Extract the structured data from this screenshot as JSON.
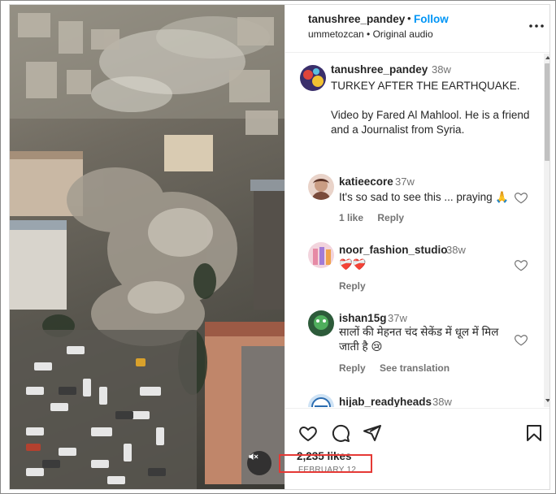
{
  "header": {
    "username": "tanushree_pandey",
    "separator": "•",
    "follow_label": "Follow",
    "location": "ummetozcan",
    "audio": "Original audio",
    "more_icon": "more-horizontal-icon"
  },
  "caption": {
    "username": "tanushree_pandey",
    "time": "38w",
    "line1": "TURKEY AFTER THE EARTHQUAKE.",
    "line2": "Video by Fared Al Mahlool. He is a friend and a Journalist from Syria."
  },
  "comments": [
    {
      "username": "katieecore",
      "time": "37w",
      "text": "It's so sad to see this ... praying 🙏",
      "likes": "1 like",
      "reply": "Reply",
      "translate": ""
    },
    {
      "username": "noor_fashion_studio",
      "time": "38w",
      "text": "❤️‍🩹❤️‍🩹",
      "likes": "",
      "reply": "Reply",
      "translate": ""
    },
    {
      "username": "ishan15g",
      "time": "37w",
      "text": "सालों की मेहनत चंद सेकेंड में धूल में मिल जाती है 😢",
      "likes": "",
      "reply": "Reply",
      "translate": "See translation"
    },
    {
      "username": "hijab_readyheads",
      "time": "38w",
      "text": "",
      "likes": "",
      "reply": "",
      "translate": ""
    }
  ],
  "actions": {
    "likes_count": "2,235 likes",
    "date": "FEBRUARY 12",
    "icons": [
      "heart-icon",
      "comment-icon",
      "share-icon",
      "bookmark-icon"
    ]
  },
  "media": {
    "mute_icon": "speaker-muted-icon"
  },
  "colors": {
    "follow_blue": "#0095f6",
    "highlight_red": "#e53935",
    "muted_text": "#737373"
  }
}
